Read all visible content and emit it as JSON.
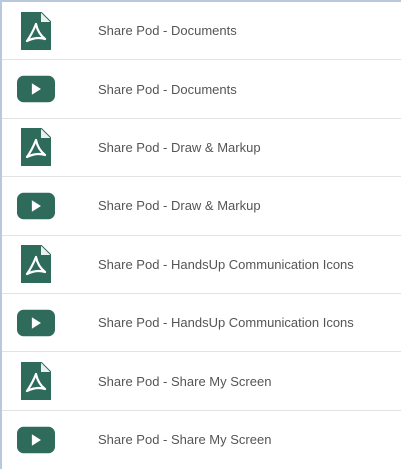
{
  "colors": {
    "icon_fill": "#2f6b5a",
    "label_text": "#555555",
    "divider": "#e3e3e3"
  },
  "items": [
    {
      "label": "Share Pod - Documents",
      "icon": "pdf-icon"
    },
    {
      "label": "Share Pod - Documents",
      "icon": "video-play-icon"
    },
    {
      "label": "Share Pod - Draw & Markup",
      "icon": "pdf-icon"
    },
    {
      "label": "Share Pod - Draw & Markup",
      "icon": "video-play-icon"
    },
    {
      "label": "Share Pod - HandsUp Communication Icons",
      "icon": "pdf-icon"
    },
    {
      "label": "Share Pod - HandsUp Communication Icons",
      "icon": "video-play-icon"
    },
    {
      "label": "Share Pod - Share My Screen",
      "icon": "pdf-icon"
    },
    {
      "label": "Share Pod - Share My Screen",
      "icon": "video-play-icon"
    }
  ]
}
